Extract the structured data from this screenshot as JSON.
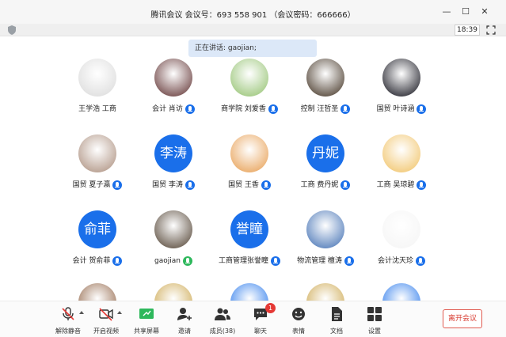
{
  "window": {
    "title": "腾讯会议  会议号：693 558 901 （会议密码：666666）",
    "minimize_glyph": "—",
    "maximize_glyph": "☐",
    "close_glyph": "✕"
  },
  "infobar": {
    "time": "18:39"
  },
  "speaking": {
    "text": "正在讲话: gaojian;"
  },
  "participants": [
    {
      "name": "王学浩 工商",
      "avatar_type": "photo",
      "avatar_color": "#d9d9d9",
      "mic": "none"
    },
    {
      "name": "会计 肖访",
      "avatar_type": "photo",
      "avatar_color": "#5a2a2a",
      "mic": "blue"
    },
    {
      "name": "商学院 刘爱香",
      "avatar_type": "photo",
      "avatar_color": "#8fbf6a",
      "mic": "blue"
    },
    {
      "name": "控制 汪哲圣",
      "avatar_type": "photo",
      "avatar_color": "#3a2a1a",
      "mic": "blue"
    },
    {
      "name": "国贸 叶诗涵",
      "avatar_type": "photo",
      "avatar_color": "#0a0a14",
      "mic": "blue"
    },
    {
      "name": "国贸 夏子瀛",
      "avatar_type": "photo",
      "avatar_color": "#a88a78",
      "mic": "blue"
    },
    {
      "name": "国贸 李涛",
      "avatar_type": "text",
      "avatar_text": "李涛",
      "mic": "blue"
    },
    {
      "name": "国贸 王香",
      "avatar_type": "photo",
      "avatar_color": "#e69a4a",
      "mic": "blue"
    },
    {
      "name": "工商 费丹妮",
      "avatar_type": "text",
      "avatar_text": "丹妮",
      "mic": "blue"
    },
    {
      "name": "工商 吴琼碧",
      "avatar_type": "photo",
      "avatar_color": "#f0c060",
      "mic": "blue"
    },
    {
      "name": "会计 贺俞菲",
      "avatar_type": "text",
      "avatar_text": "俞菲",
      "mic": "blue"
    },
    {
      "name": "gaojian",
      "avatar_type": "photo",
      "avatar_color": "#4a3a2a",
      "mic": "green"
    },
    {
      "name": "工商管理张誉瞳",
      "avatar_type": "text",
      "avatar_text": "誉瞳",
      "mic": "blue"
    },
    {
      "name": "物流管理 檀涛",
      "avatar_type": "photo",
      "avatar_color": "#3a6ab0",
      "mic": "blue"
    },
    {
      "name": "会计沈天珍",
      "avatar_type": "photo",
      "avatar_color": "#f4f4f4",
      "mic": "blue"
    }
  ],
  "partial_row": [
    {
      "avatar_color": "#8a5a3a"
    },
    {
      "avatar_color": "#c8a040"
    },
    {
      "avatar_color": "#1a6fea"
    },
    {
      "avatar_color": "#c8a040"
    },
    {
      "avatar_color": "#1a6fea"
    }
  ],
  "toolbar": {
    "unmute": "解除静音",
    "start_video": "开启视频",
    "share_screen": "共享屏幕",
    "invite": "邀请",
    "members": "成员(38)",
    "chat": "聊天",
    "chat_badge": "1",
    "reactions": "表情",
    "docs": "文档",
    "settings": "设置",
    "leave": "离开会议"
  },
  "colors": {
    "accent": "#1a6fea",
    "speaking_mic": "#2eb85c",
    "leave": "#d83a2f",
    "badge": "#e53935"
  }
}
